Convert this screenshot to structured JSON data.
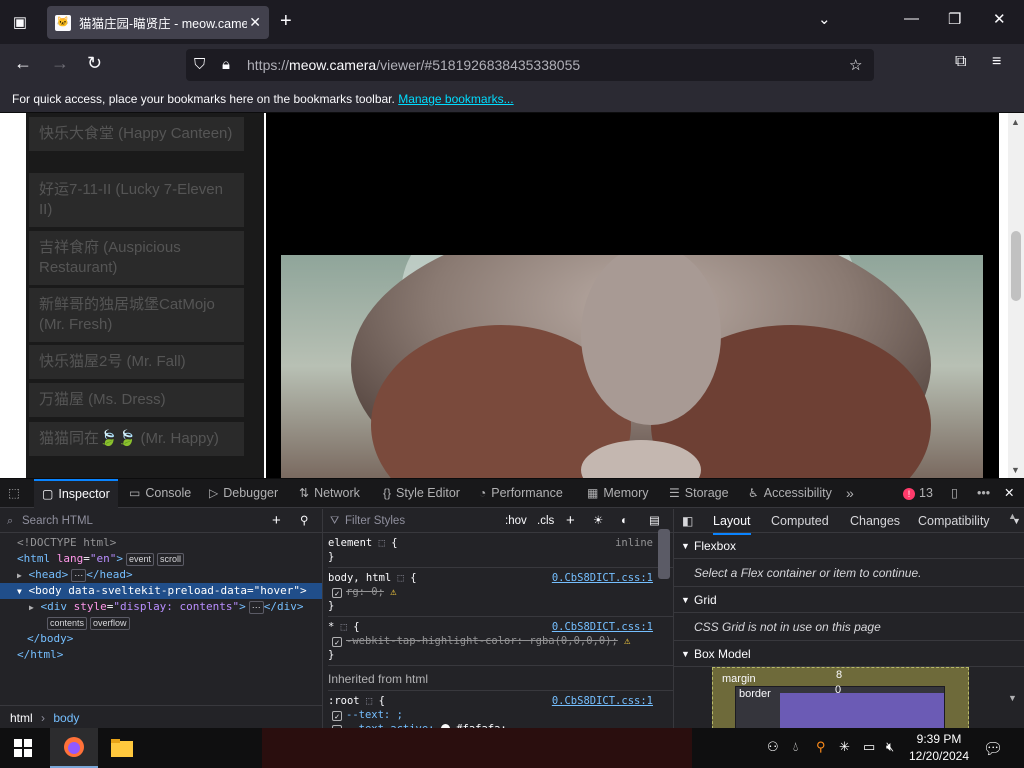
{
  "browser": {
    "tab_title": "猫猫庄园-瞄贤庄 - meow.camera",
    "url_prefix": "https://",
    "url_host": "meow.camera",
    "url_path": "/viewer/#5181926838435338055",
    "bookmarks_text": "For quick access, place your bookmarks here on the bookmarks toolbar.",
    "bookmarks_link": "Manage bookmarks..."
  },
  "page": {
    "cameras": [
      "快乐大食堂 (Happy Canteen)",
      "好运7-11-II (Lucky 7-Eleven II)",
      "吉祥食府 (Auspicious Restaurant)",
      "新鲜哥的独居城堡CatMojo (Mr. Fresh)",
      "快乐猫屋2号 (Mr. Fall)",
      "万猫屋 (Ms. Dress)",
      "猫猫同在🍃🍃 (Mr. Happy)"
    ]
  },
  "devtools": {
    "tabs": [
      "Inspector",
      "Console",
      "Debugger",
      "Network",
      "Style Editor",
      "Performance",
      "Memory",
      "Storage",
      "Accessibility"
    ],
    "error_count": "13",
    "search_placeholder": "Search HTML",
    "filter_placeholder": "Filter Styles",
    "hov": ":hov",
    "cls": ".cls",
    "html_tree": {
      "doctype": "<!DOCTYPE html>",
      "html_open_tag": "<html",
      "html_lang_attr": "lang",
      "html_lang_val": "\"en\"",
      "badge_event": "event",
      "badge_scroll": "scroll",
      "head": "<head>",
      "head_close": "</head>",
      "body_open": "<body",
      "body_attr": "data-sveltekit-preload-data",
      "body_val": "\"hover\"",
      "div_open": "<div",
      "div_attr": "style",
      "div_val": "\"display: contents\"",
      "div_close": "</div>",
      "badge_contents": "contents",
      "badge_overflow": "overflow",
      "body_close": "</body>",
      "html_close": "</html>"
    },
    "breadcrumbs": [
      "html",
      "body"
    ],
    "rules": {
      "element_selector": "element",
      "element_src": "inline",
      "body_selector": "body, html",
      "body_src": "0.CbS8DICT.css:1",
      "body_prop": "rg: 0;",
      "star_selector": "*",
      "star_src": "0.CbS8DICT.css:1",
      "star_prop": "-webkit-tap-highlight-color: rgba(0,0,0,0);",
      "inherited": "Inherited from html",
      "root_selector": ":root",
      "root_src": "0.CbS8DICT.css:1",
      "root_prop1": "--text: ;",
      "root_prop2": "--text-active:",
      "root_prop2_val": "#fafafa;"
    },
    "layout_tabs": [
      "Layout",
      "Computed",
      "Changes",
      "Compatibility"
    ],
    "flexbox_head": "Flexbox",
    "flexbox_msg": "Select a Flex container or item to continue.",
    "grid_head": "Grid",
    "grid_msg": "CSS Grid is not in use on this page",
    "boxmodel_head": "Box Model",
    "bm_margin": "margin",
    "bm_margin_val": "8",
    "bm_border": "border",
    "bm_border_val": "0"
  },
  "taskbar": {
    "time": "9:39 PM",
    "date": "12/20/2024"
  },
  "colors": {
    "accent": "#0a84ff",
    "link": "#00ddff"
  }
}
